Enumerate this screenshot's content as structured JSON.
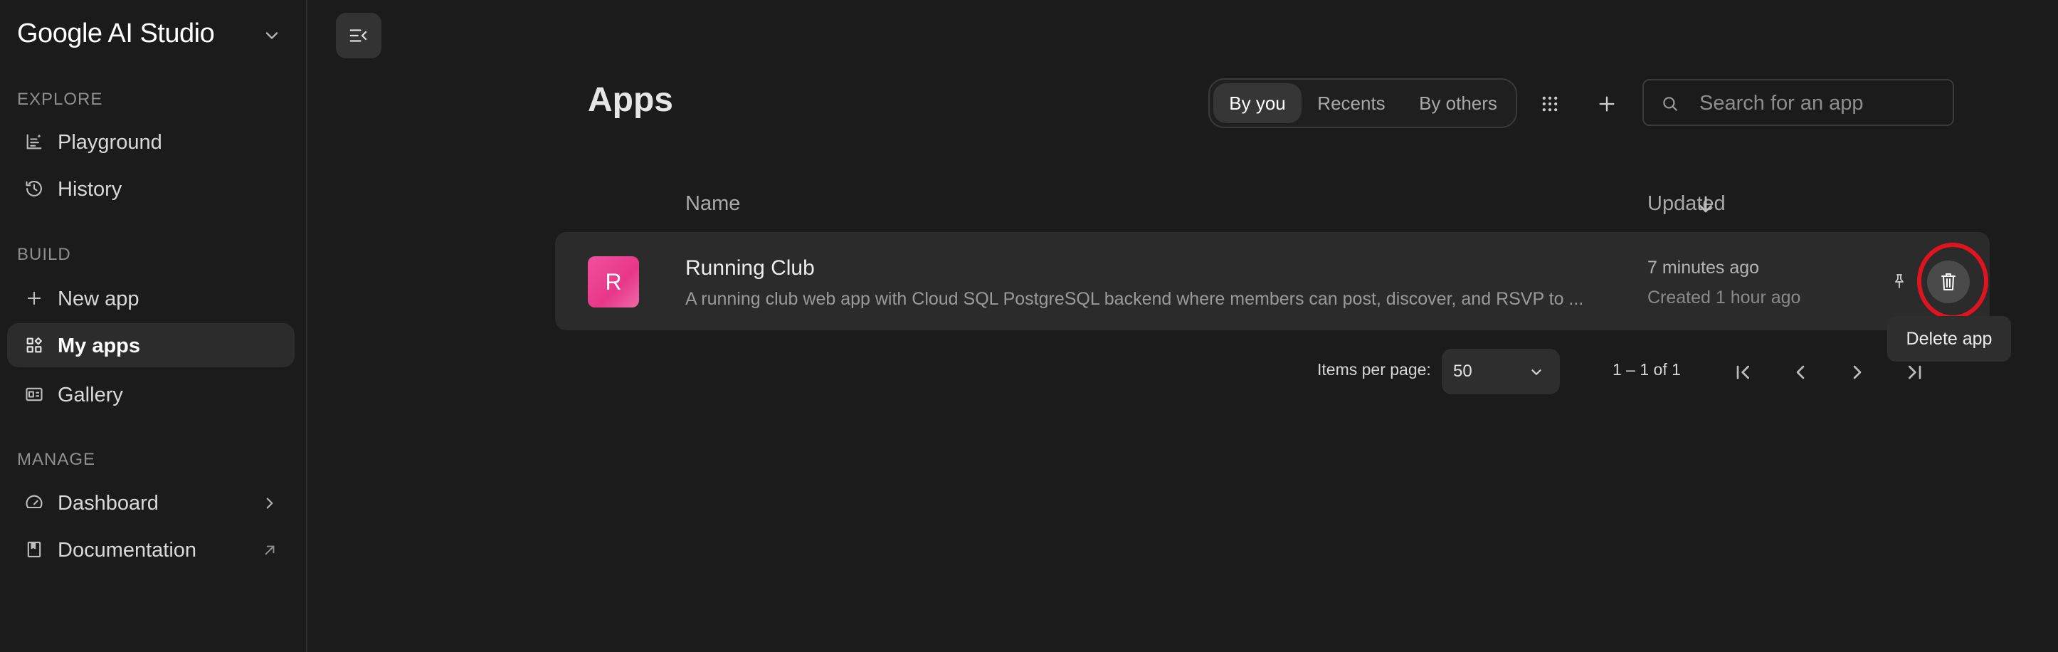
{
  "app": {
    "brand": "Google AI Studio"
  },
  "sidebar": {
    "sections": [
      {
        "label": "EXPLORE"
      },
      {
        "label": "BUILD"
      },
      {
        "label": "MANAGE"
      }
    ],
    "items": [
      {
        "label": "Playground",
        "icon": "playground-icon"
      },
      {
        "label": "History",
        "icon": "history-icon"
      },
      {
        "label": "New app",
        "icon": "plus-icon"
      },
      {
        "label": "My apps",
        "icon": "grid-icon",
        "active": true
      },
      {
        "label": "Gallery",
        "icon": "gallery-icon"
      },
      {
        "label": "Dashboard",
        "icon": "gauge-icon",
        "trailing": "chevron-right-icon"
      },
      {
        "label": "Documentation",
        "icon": "book-icon",
        "trailing": "external-link-icon"
      }
    ]
  },
  "header": {
    "title": "Apps",
    "filters": [
      {
        "label": "By you",
        "active": true
      },
      {
        "label": "Recents"
      },
      {
        "label": "By others"
      }
    ],
    "search": {
      "placeholder": "Search for an app",
      "value": ""
    }
  },
  "table": {
    "columns": {
      "name": "Name",
      "updated": "Updated"
    },
    "sort": "descending",
    "rows": [
      {
        "initial": "R",
        "name": "Running Club",
        "description": "A running club web app with Cloud SQL PostgreSQL backend where members can post, discover, and RSVP to ...",
        "updated": "7 minutes ago",
        "created": "Created 1 hour ago"
      }
    ],
    "row_actions": {
      "delete_tooltip": "Delete app"
    }
  },
  "pagination": {
    "items_per_page_label": "Items per page:",
    "items_per_page": "50",
    "range": "1 – 1 of 1"
  },
  "colors": {
    "background": "#1b1b1b",
    "row": "#2b2b2b",
    "avatar": "#e8378a",
    "highlight": "#e0141e"
  }
}
